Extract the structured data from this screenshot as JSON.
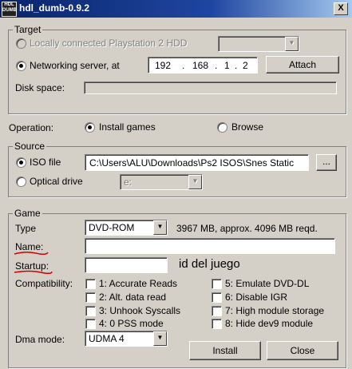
{
  "window": {
    "title": "hdl_dumb-0.9.2",
    "icon_text": "HDL DUMB",
    "close_glyph": "X"
  },
  "target": {
    "legend": "Target",
    "local_hdd_label": "Locally connected Playstation 2 HDD",
    "network_label": "Networking server, at",
    "ip": [
      "192",
      "168",
      "1",
      "2"
    ],
    "attach_label": "Attach",
    "disk_space_label": "Disk space:"
  },
  "operation": {
    "label": "Operation:",
    "install_label": "Install games",
    "browse_label": "Browse",
    "selected": "install"
  },
  "source": {
    "legend": "Source",
    "iso_label": "ISO file",
    "iso_path": "C:\\Users\\ALU\\Downloads\\Ps2 ISOS\\Snes Static",
    "browse_dots": "...",
    "optical_label": "Optical drive",
    "drive_value": "e:"
  },
  "game": {
    "legend": "Game",
    "type_label": "Type",
    "type_value": "DVD-ROM",
    "size_text": "3967 MB, approx. 4096 MB reqd.",
    "name_label": "Name:",
    "name_value": "",
    "startup_label": "Startup:",
    "startup_value": "",
    "annotation": "id del juego",
    "compat_label": "Compatibility:",
    "compat": [
      "1: Accurate Reads",
      "2: Alt. data read",
      "3: Unhook Syscalls",
      "4: 0 PSS mode",
      "5: Emulate DVD-DL",
      "6: Disable IGR",
      "7: High module storage",
      "8: Hide dev9 module"
    ],
    "dma_label": "Dma mode:",
    "dma_value": "UDMA 4"
  },
  "buttons": {
    "install_label": "Install",
    "close_label": "Close"
  },
  "colors": {
    "title_bar": "#0a246a",
    "face": "#d4d0c8",
    "annotation_underline": "#d00000"
  }
}
